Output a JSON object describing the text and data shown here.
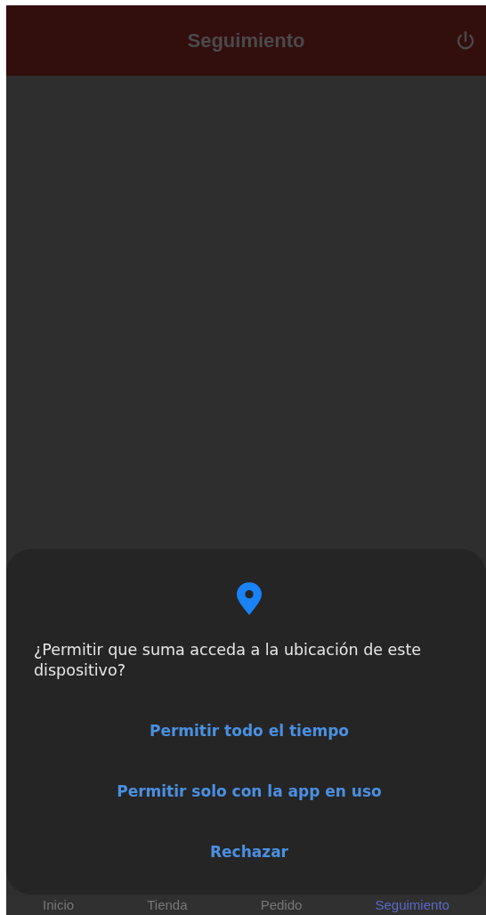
{
  "header": {
    "title": "Seguimiento"
  },
  "permission_dialog": {
    "message": "¿Permitir que suma acceda a la ubicación de este dispositivo?",
    "buttons": [
      "Permitir todo el tiempo",
      "Permitir solo con la app en uso",
      "Rechazar"
    ]
  },
  "bottom_tabs": [
    {
      "label": "Inicio",
      "selected": false
    },
    {
      "label": "Tienda",
      "selected": false
    },
    {
      "label": "Pedido",
      "selected": false
    },
    {
      "label": "Seguimiento",
      "selected": true
    }
  ]
}
